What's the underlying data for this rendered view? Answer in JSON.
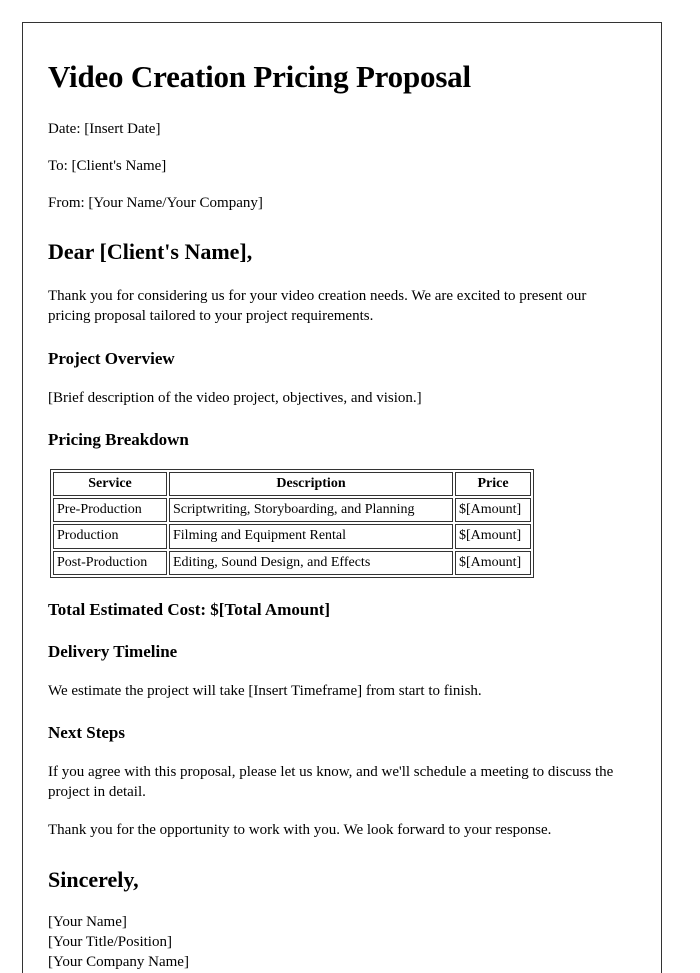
{
  "document": {
    "title": "Video Creation Pricing Proposal",
    "meta": [
      "Date: [Insert Date]",
      "To: [Client's Name]",
      "From: [Your Name/Your Company]"
    ],
    "salutation": "Dear [Client's Name],",
    "intro_paragraph": "Thank you for considering us for your video creation needs. We are excited to present our pricing proposal tailored to your project requirements.",
    "project_overview": {
      "heading": "Project Overview",
      "body": "[Brief description of the video project, objectives, and vision.]"
    },
    "pricing_breakdown": {
      "heading": "Pricing Breakdown",
      "columns": [
        "Service",
        "Description",
        "Price"
      ],
      "rows": [
        [
          "Pre-Production",
          "Scriptwriting, Storyboarding, and Planning",
          "$[Amount]"
        ],
        [
          "Production",
          "Filming and Equipment Rental",
          "$[Amount]"
        ],
        [
          "Post-Production",
          "Editing, Sound Design, and Effects",
          "$[Amount]"
        ]
      ]
    },
    "total_cost_heading": "Total Estimated Cost: $[Total Amount]",
    "delivery_timeline": {
      "heading": "Delivery Timeline",
      "body": "We estimate the project will take [Insert Timeframe] from start to finish."
    },
    "next_steps": {
      "heading": "Next Steps",
      "body": "If you agree with this proposal, please let us know, and we'll schedule a meeting to discuss the project in detail."
    },
    "closing_paragraph": "Thank you for the opportunity to work with you. We look forward to your response.",
    "signoff": "Sincerely,",
    "signature_lines": [
      "[Your Name]",
      "[Your Title/Position]",
      "[Your Company Name]"
    ]
  },
  "colors": {
    "page_border": "#333333",
    "text": "#000000",
    "background": "#ffffff"
  }
}
